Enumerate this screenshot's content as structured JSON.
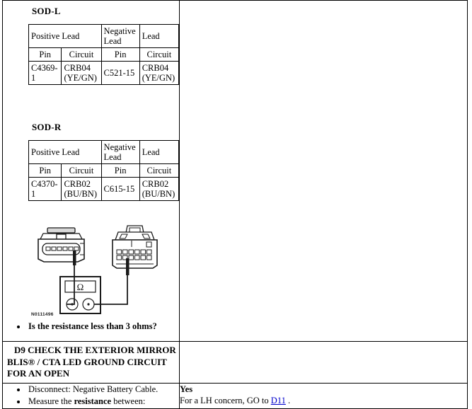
{
  "document": {
    "image_code": "N0111496"
  },
  "sod_l": {
    "title": "SOD-L",
    "headers": {
      "positive": "Positive Lead",
      "negative": "Negative Lead",
      "pin": "Pin",
      "circuit": "Circuit"
    },
    "row": {
      "pos_pin": "C4369-1",
      "pos_circuit": "CRB04 (YE/GN)",
      "neg_pin": "C521-15",
      "neg_circuit": "CRB04 (YE/GN)"
    }
  },
  "sod_r": {
    "title": "SOD-R",
    "headers": {
      "positive": "Positive Lead",
      "negative": "Negative Lead",
      "pin": "Pin",
      "circuit": "Circuit"
    },
    "row": {
      "pos_pin": "C4370-1",
      "pos_circuit": "CRB02 (BU/BN)",
      "neg_pin": "C615-15",
      "neg_circuit": "CRB02 (BU/BN)"
    }
  },
  "diagram": {
    "meter_symbol": "Ω",
    "caption": "N0111496"
  },
  "question_step": {
    "bullet": "Is the resistance less than 3 ohms?"
  },
  "step_d9": {
    "header": "D9 CHECK THE EXTERIOR MIRROR BLIS® / CTA LED GROUND CIRCUIT FOR AN OPEN",
    "bullets": [
      "Disconnect: Negative Battery Cable.",
      "Measure the resistance between:"
    ],
    "bullet2_prefix": "Measure the ",
    "bullet2_strong": "resistance",
    "bullet2_suffix": " between:"
  },
  "result_d9": {
    "yes": "Yes",
    "text_before": "For a LH concern, GO to ",
    "link": "D11",
    "text_after": " ."
  },
  "colors": {
    "link": "#0000cc",
    "border": "#000000",
    "text": "#000000"
  }
}
